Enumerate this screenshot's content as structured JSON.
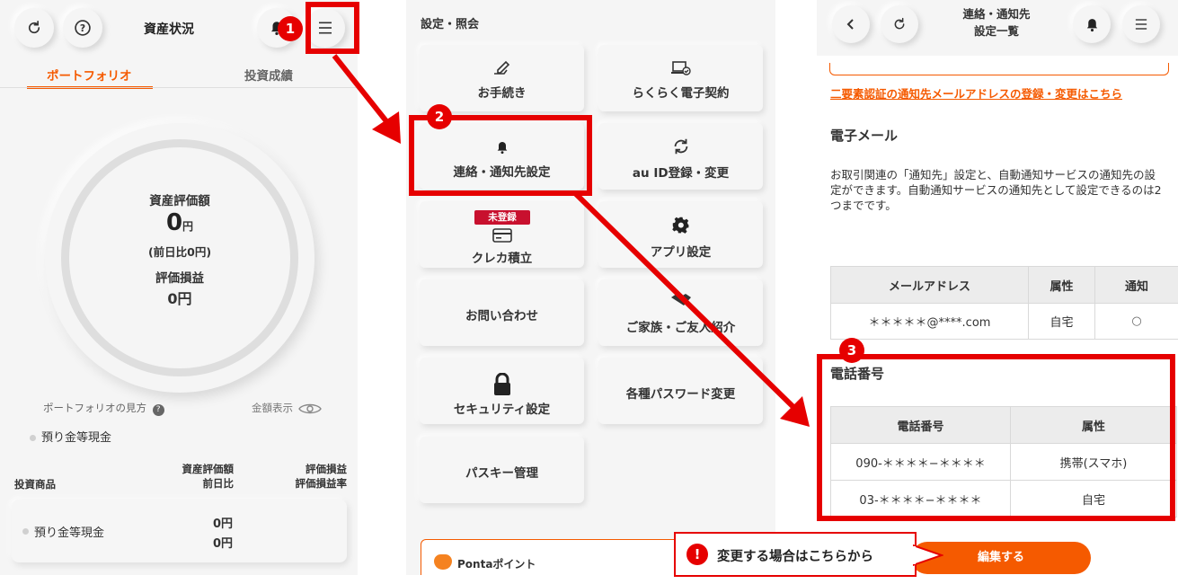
{
  "panel1": {
    "header": {
      "title": "資産状況",
      "refresh_icon": "refresh-icon",
      "help_icon": "question-circle-icon",
      "bell_icon": "bell-icon",
      "menu_icon": "menu-icon"
    },
    "tabs": [
      {
        "label": "ポートフォリオ",
        "active": true
      },
      {
        "label": "投資成績",
        "active": false
      }
    ],
    "summary": {
      "asset_label": "資産評価額",
      "asset_value": "0",
      "asset_unit": "円",
      "day_change": "(前日比0円)",
      "pnl_label": "評価損益",
      "pnl_value": "0円"
    },
    "portfolio_view_link": "ポートフォリオの見方",
    "amount_toggle": "金額表示",
    "legend_item": "預り金等現金",
    "table_header": {
      "product": "投資商品",
      "value_col_top": "資産評価額",
      "value_col_bottom": "前日比",
      "pnl_col_top": "評価損益",
      "pnl_col_bottom": "評価損益率"
    },
    "row": {
      "name": "預り金等現金",
      "value": "0円",
      "change": "0円"
    }
  },
  "panel2": {
    "title": "設定・照会",
    "tiles": [
      {
        "label": "お手続き",
        "icon": "pen-hand-icon"
      },
      {
        "label": "らくらく電子契約",
        "icon": "laptop-check-icon"
      },
      {
        "label": "連絡・通知先設定",
        "icon": "bell-icon"
      },
      {
        "label": "au ID登録・変更",
        "icon": "sync-icon"
      },
      {
        "label": "クレカ積立",
        "icon": "credit-card-icon",
        "badge": "未登録"
      },
      {
        "label": "アプリ設定",
        "icon": "gear-icon"
      },
      {
        "label": "お問い合わせ",
        "icon": ""
      },
      {
        "label": "ご家族・ご友人紹介",
        "icon": "handshake-icon"
      },
      {
        "label": "セキュリティ設定",
        "icon": "lock-icon"
      },
      {
        "label": "各種パスワード変更",
        "icon": ""
      },
      {
        "label": "パスキー管理",
        "icon": ""
      }
    ],
    "ponta_label": "Pontaポイント"
  },
  "panel3": {
    "header": {
      "title_line1": "連絡・通知先",
      "title_line2": "設定一覧",
      "back_icon": "chevron-left-icon",
      "refresh_icon": "refresh-icon",
      "bell_icon": "bell-icon",
      "menu_icon": "menu-icon"
    },
    "two_factor_link": "二要素認証の通知先メールアドレスの登録・変更はこちら",
    "email_heading": "電子メール",
    "email_description": "お取引関連の「通知先」設定と、自動通知サービスの通知先の設定ができます。自動通知サービスの通知先として設定できるのは2つまでです。",
    "email_table": {
      "col_address": "メールアドレス",
      "col_attr": "属性",
      "col_notify": "通知",
      "row": {
        "address": "＊＊＊＊＊@****.com",
        "attr": "自宅",
        "notify": "○"
      }
    },
    "phone_heading": "電話番号",
    "phone_table": {
      "col_number": "電話番号",
      "col_attr": "属性",
      "rows": [
        {
          "number": "090-＊＊＊＊−＊＊＊＊",
          "attr": "携帯(スマホ)"
        },
        {
          "number": "03-＊＊＊＊−＊＊＊＊",
          "attr": "自宅"
        }
      ]
    },
    "edit_button": "編集する"
  },
  "annotations": {
    "step1": "1",
    "step2": "2",
    "step3": "3",
    "callout": "変更する場合はこちらから",
    "callout_icon": "exclamation-circle-icon",
    "accent_red": "#e60000",
    "accent_orange": "#f55a00"
  }
}
